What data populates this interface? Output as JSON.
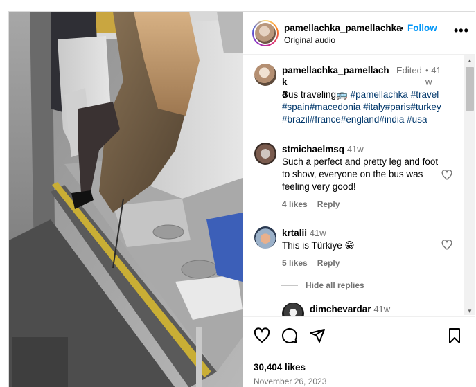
{
  "post": {
    "username": "pamellachka_pamellachka",
    "dot": "•",
    "follow_label": "Follow",
    "audio": "Original audio",
    "more_label": "•••"
  },
  "caption": {
    "username_line1": "pamellachka_pamellachk",
    "username_line2": "a",
    "edited": "Edited",
    "dot": "•",
    "age": "41 w",
    "text_prefix": "Bus traveling",
    "bus_emoji": "🚌",
    "hashtags_line1": [
      "#pamellachka",
      "#travel"
    ],
    "hashtags_line2": [
      "#spain",
      "#macedonia",
      "#italy",
      "#paris",
      "#turkey"
    ],
    "hashtags_line3": [
      "#brazil",
      "#france",
      "#england",
      "#india",
      "#usa"
    ]
  },
  "comments": [
    {
      "username": "stmichaelmsq",
      "age": "41w",
      "text": "Such a perfect and pretty leg and foot to show, everyone on the bus was feeling very good!",
      "likes": "4 likes",
      "reply": "Reply"
    },
    {
      "username": "krtalii",
      "age": "41w",
      "text": "This is Türkiye",
      "emoji": "😁",
      "likes": "5 likes",
      "reply": "Reply"
    }
  ],
  "hide_replies": "Hide all replies",
  "reply_preview": {
    "username": "dimchevardar",
    "age": "41w"
  },
  "footer": {
    "likes": "30,404 likes",
    "date": "November 26, 2023"
  },
  "colors": {
    "link": "#0095f6",
    "hashtag": "#00376b",
    "muted": "#737373"
  },
  "icons": [
    "heart-icon",
    "comment-icon",
    "share-icon",
    "bookmark-icon",
    "more-icon"
  ]
}
